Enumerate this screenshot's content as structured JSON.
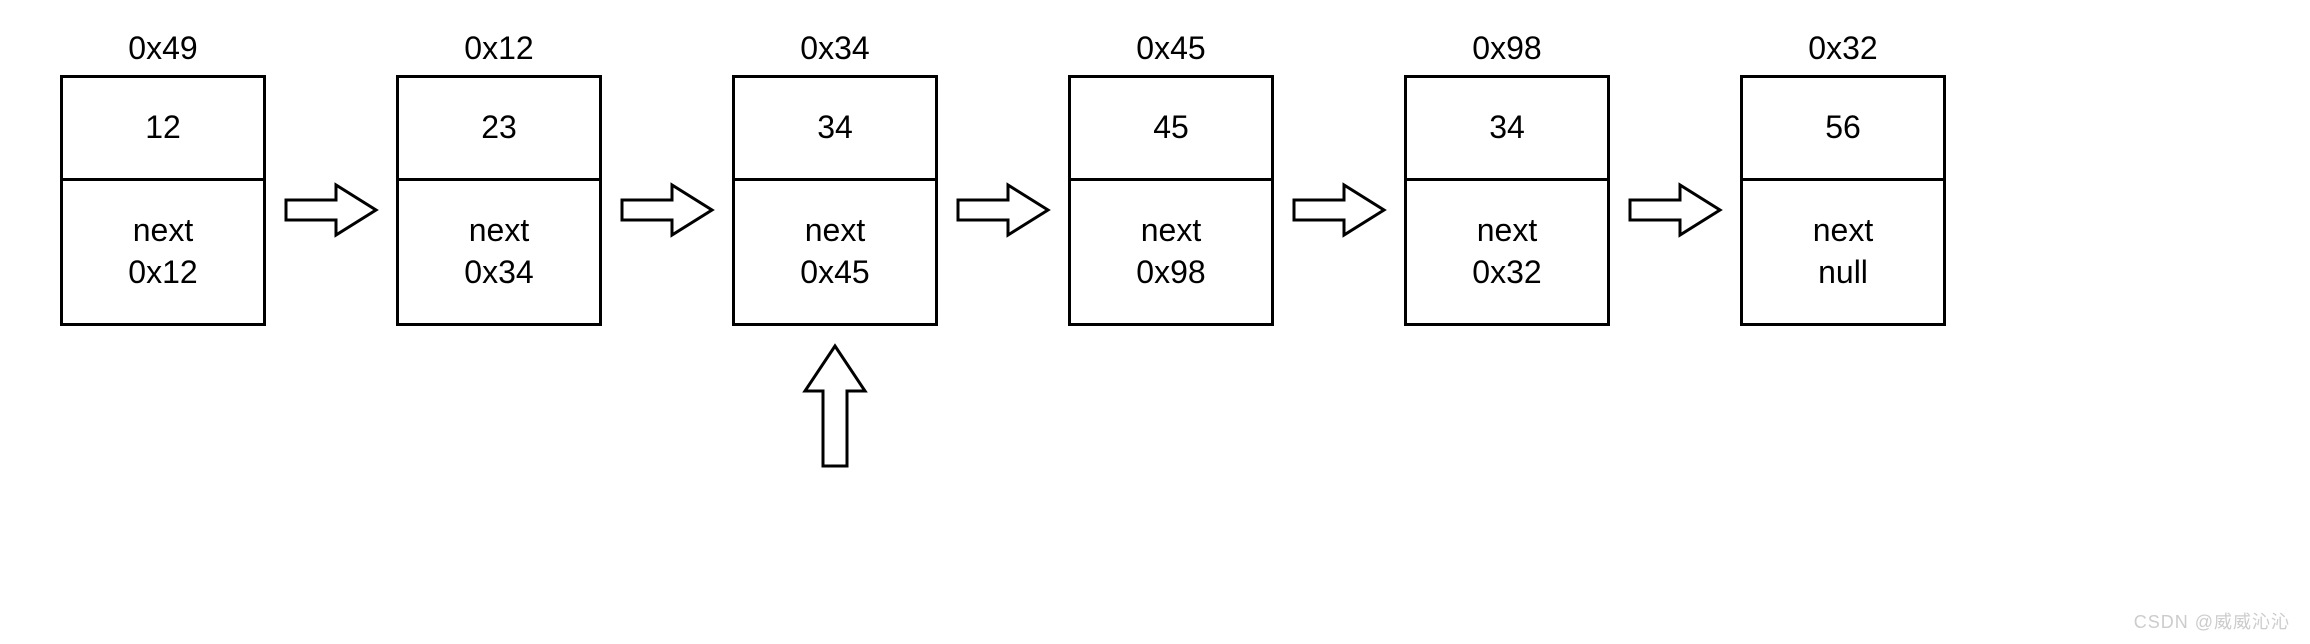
{
  "nodes": [
    {
      "address": "0x49",
      "value": "12",
      "next_label": "next",
      "next_addr": "0x12"
    },
    {
      "address": "0x12",
      "value": "23",
      "next_label": "next",
      "next_addr": "0x34"
    },
    {
      "address": "0x34",
      "value": "34",
      "next_label": "next",
      "next_addr": "0x45"
    },
    {
      "address": "0x45",
      "value": "45",
      "next_label": "next",
      "next_addr": "0x98"
    },
    {
      "address": "0x98",
      "value": "34",
      "next_label": "next",
      "next_addr": "0x32"
    },
    {
      "address": "0x32",
      "value": "56",
      "next_label": "next",
      "next_addr": "null"
    }
  ],
  "indicator_target_index": 2,
  "watermark": "CSDN @威威沁沁"
}
